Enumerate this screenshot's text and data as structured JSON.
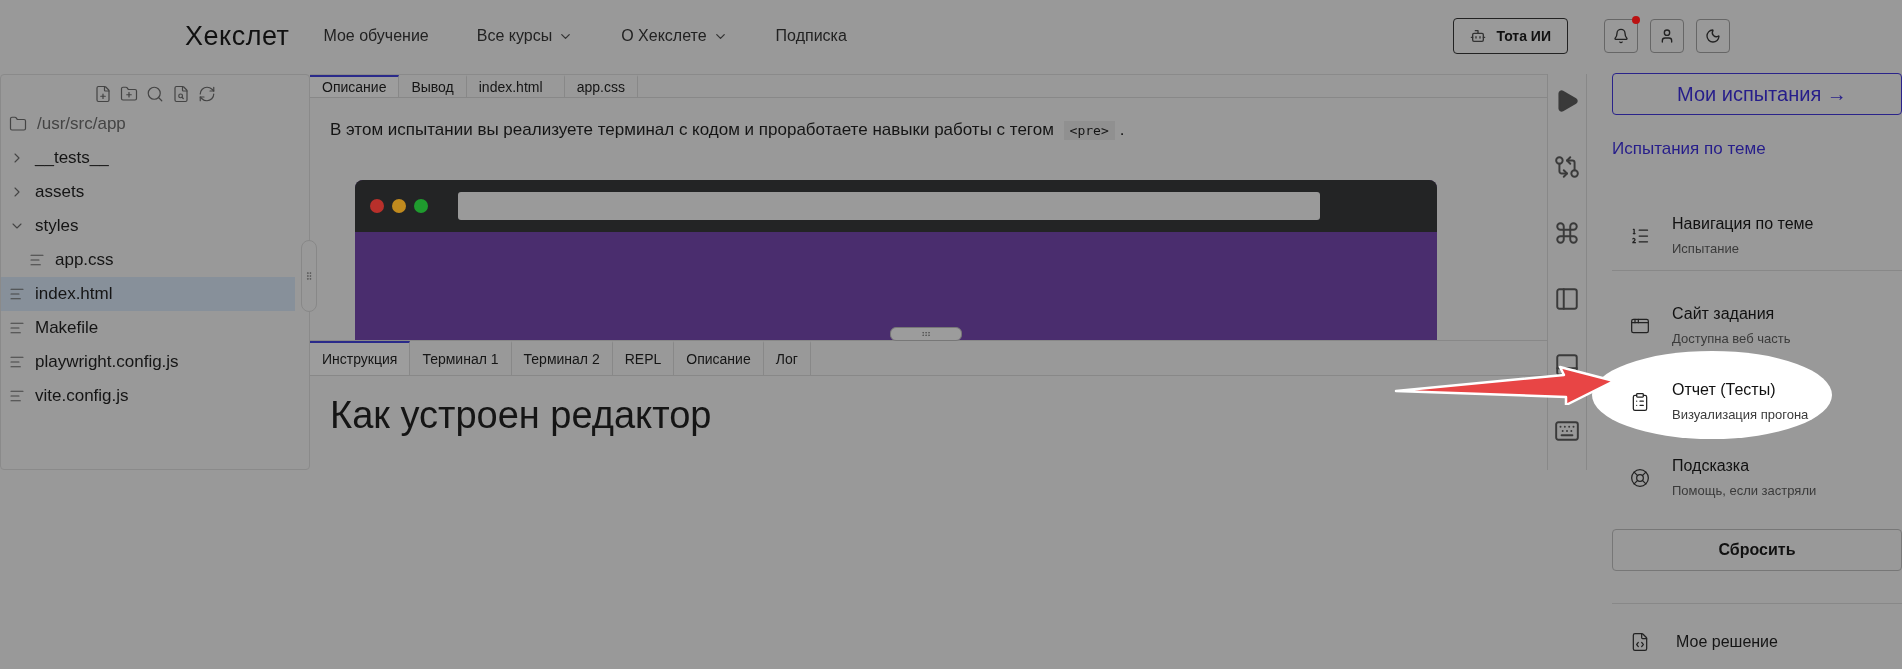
{
  "header": {
    "logo": "Хекслет",
    "nav": [
      {
        "label": "Мое обучение",
        "dropdown": false
      },
      {
        "label": "Все курсы",
        "dropdown": true
      },
      {
        "label": "О Хекслете",
        "dropdown": true
      },
      {
        "label": "Подписка",
        "dropdown": false
      }
    ],
    "ai_button": "Тота ИИ",
    "notifications": {
      "unread": true
    }
  },
  "file_tree": {
    "root": "/usr/src/app",
    "items": [
      {
        "name": "__tests__",
        "kind": "folder",
        "expanded": false,
        "selected": false
      },
      {
        "name": "assets",
        "kind": "folder",
        "expanded": false,
        "selected": false
      },
      {
        "name": "styles",
        "kind": "folder",
        "expanded": true,
        "selected": false,
        "children": [
          {
            "name": "app.css",
            "kind": "file",
            "selected": false
          }
        ]
      },
      {
        "name": "index.html",
        "kind": "file",
        "selected": true
      },
      {
        "name": "Makefile",
        "kind": "file",
        "selected": false
      },
      {
        "name": "playwright.config.js",
        "kind": "file",
        "selected": false
      },
      {
        "name": "vite.config.js",
        "kind": "file",
        "selected": false
      }
    ]
  },
  "editor": {
    "tabs": [
      {
        "label": "Описание",
        "selected": true
      },
      {
        "label": "Вывод",
        "selected": false
      },
      {
        "label": "index.html",
        "selected": false
      },
      {
        "label": "app.css",
        "selected": false
      }
    ],
    "description": "В этом испытании вы реализуете терминал с кодом и проработаете навыки работы с тегом",
    "code_tag": "<pre>",
    "trailing": "."
  },
  "bottom_panel": {
    "tabs": [
      {
        "label": "Инструкция",
        "selected": true
      },
      {
        "label": "Терминал 1",
        "selected": false
      },
      {
        "label": "Терминал 2",
        "selected": false
      },
      {
        "label": "REPL",
        "selected": false
      },
      {
        "label": "Описание",
        "selected": false
      },
      {
        "label": "Лог",
        "selected": false
      }
    ],
    "heading": "Как устроен редактор"
  },
  "sidebar": {
    "my_challenges": "Мои испытания",
    "arrow": "→",
    "topic_link": "Испытания по теме",
    "items": [
      {
        "title": "Навигация по теме",
        "subtitle": "Испытание",
        "highlighted": false,
        "divider_after": true
      },
      {
        "title": "Сайт задания",
        "subtitle": "Доступна веб часть",
        "highlighted": false,
        "divider_after": false
      },
      {
        "title": "Отчет (Тесты)",
        "subtitle": "Визуализация прогона",
        "highlighted": true,
        "divider_after": false
      },
      {
        "title": "Подсказка",
        "subtitle": "Помощь, если застряли",
        "highlighted": false,
        "divider_after": false
      }
    ],
    "reset_button": "Сбросить",
    "solution": "Мое решение"
  }
}
